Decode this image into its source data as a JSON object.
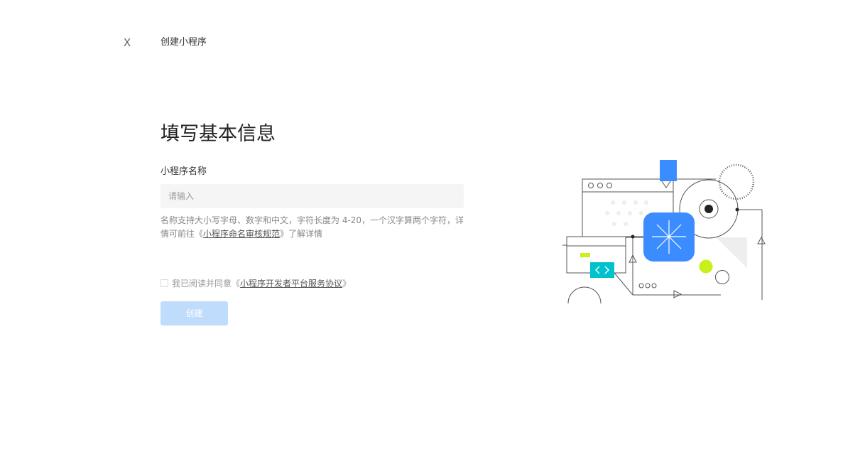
{
  "header": {
    "close_label": "X",
    "title": "创建小程序"
  },
  "form": {
    "heading": "填写基本信息",
    "name_label": "小程序名称",
    "name_placeholder": "请输入",
    "name_value": "",
    "hint_prefix": "名称支持大小写字母、数字和中文，字符长度为 4-20，一个汉字算两个字符，详情可前往《",
    "hint_link": "小程序命名审核规范",
    "hint_suffix": "》了解详情",
    "agree_prefix": "我已阅读并同意《",
    "agree_link": "小程序开发者平台服务协议",
    "agree_suffix": "》",
    "agree_checked": false,
    "submit_label": "创建",
    "submit_enabled": false
  },
  "illustration": {
    "accent_blue": "#3b8cff",
    "accent_cyan": "#00c2cc",
    "accent_lime": "#c8f01a",
    "line_color": "#555555"
  }
}
